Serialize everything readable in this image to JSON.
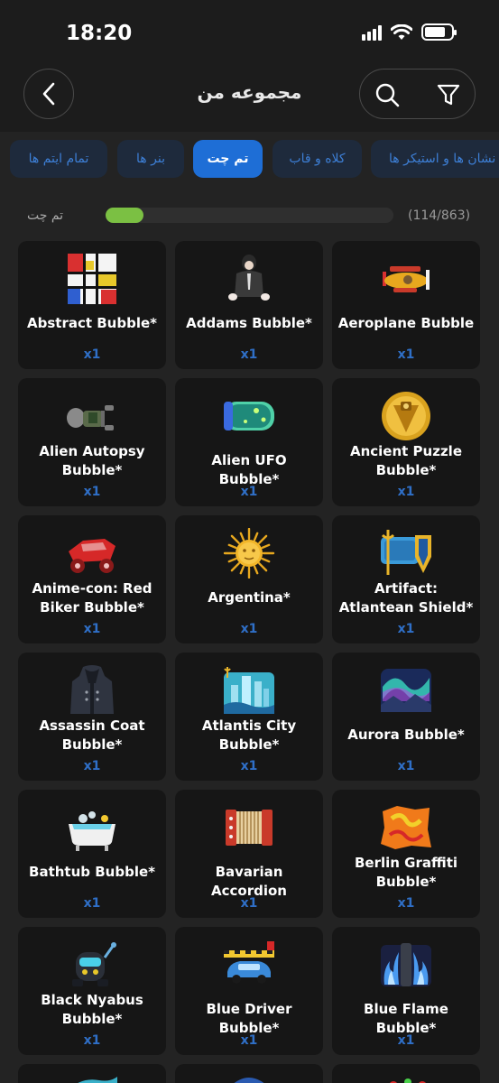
{
  "status": {
    "time": "18:20"
  },
  "header": {
    "title": "مجموعه من"
  },
  "tabs": [
    {
      "label": "نشان ها و استیکر ها",
      "active": false
    },
    {
      "label": "کلاه و قاب",
      "active": false
    },
    {
      "label": "تم چت",
      "active": true
    },
    {
      "label": "بنر ها",
      "active": false
    },
    {
      "label": "تمام ایتم ها",
      "active": false
    }
  ],
  "progress": {
    "label": "تم چت",
    "count": "(114/863)",
    "fraction": 0.132
  },
  "items": [
    {
      "name": "Abstract Bubble*",
      "qty": "x1",
      "icon": "mondrian-icon"
    },
    {
      "name": "Addams Bubble*",
      "qty": "x1",
      "icon": "suit-figure-icon"
    },
    {
      "name": "Aeroplane Bubble",
      "qty": "x1",
      "icon": "aeroplane-icon"
    },
    {
      "name": "Alien Autopsy Bubble*",
      "qty": "x1",
      "icon": "alien-body-icon"
    },
    {
      "name": "Alien UFO Bubble*",
      "qty": "x1",
      "icon": "ufo-icon"
    },
    {
      "name": "Ancient Puzzle Bubble*",
      "qty": "x1",
      "icon": "gold-puzzle-icon"
    },
    {
      "name": "Anime-con: Red Biker Bubble*",
      "qty": "x1",
      "icon": "red-bike-icon"
    },
    {
      "name": "Argentina*",
      "qty": "x1",
      "icon": "sun-of-may-icon"
    },
    {
      "name": "Artifact: Atlantean Shield*",
      "qty": "x1",
      "icon": "trident-shield-icon"
    },
    {
      "name": "Assassin Coat Bubble*",
      "qty": "x1",
      "icon": "coat-icon"
    },
    {
      "name": "Atlantis City Bubble*",
      "qty": "x1",
      "icon": "underwater-city-icon"
    },
    {
      "name": "Aurora Bubble*",
      "qty": "x1",
      "icon": "aurora-icon"
    },
    {
      "name": "Bathtub Bubble*",
      "qty": "x1",
      "icon": "bathtub-icon"
    },
    {
      "name": "Bavarian Accordion",
      "qty": "x1",
      "icon": "accordion-icon"
    },
    {
      "name": "Berlin Graffiti Bubble*",
      "qty": "x1",
      "icon": "graffiti-icon"
    },
    {
      "name": "Black Nyabus Bubble*",
      "qty": "x1",
      "icon": "robot-bus-icon"
    },
    {
      "name": "Blue Driver Bubble*",
      "qty": "x1",
      "icon": "blue-car-icon"
    },
    {
      "name": "Blue Flame Bubble*",
      "qty": "x1",
      "icon": "blue-flame-icon"
    }
  ]
}
